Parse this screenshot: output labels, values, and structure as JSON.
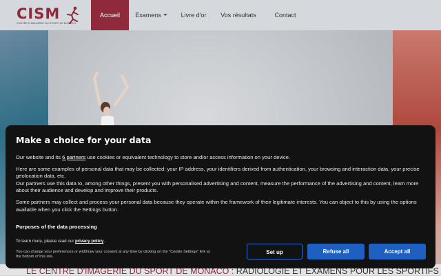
{
  "header": {
    "logo": {
      "name": "CISM",
      "subtitle": "CENTRE D'IMAGERIE DU SPORT DE MONACO"
    },
    "nav": [
      {
        "label": "Accueil",
        "active": true
      },
      {
        "label": "Examens",
        "has_dropdown": true
      },
      {
        "label": "Livre d'or"
      },
      {
        "label": "Vos résultats"
      },
      {
        "label": "Contact"
      }
    ]
  },
  "hero": {
    "tagline_part1": "LE CENTRE D'IMAGERIE DU SPORT DE MONACO :",
    "tagline_part2": "RADIOLOGIE ET EXAMENS POUR LES SPORTIFS"
  },
  "consent": {
    "title": "Make a choice for your data",
    "para1_before": "Our website and its ",
    "para1_link": "6 partners",
    "para1_after": " use cookies or equivalent technology to store and/or access information on your device.",
    "para2": "Here are some examples of personal data that may be collected: your IP address, your identifiers derived from authentication, your browsing and interaction data, your precise geolocation data, etc.",
    "para3": "Our partners use this data to, among other things, present you with personalised advertising and content, measure the performance of the advertising and content, learn more about their audience and develop and improve their products.",
    "para4": "Some partners may collect and process your personal data because they operate within the framework of their legitimate interests. You can object to this by using the options available when you click the Settings button.",
    "purposes_heading": "Purposes of the data processing",
    "learn_more_before": "To learn more, please read our ",
    "learn_more_link": "privacy policy",
    "learn_more_after": ".",
    "preferences_note": "You can change your preferences or widthraw your consent at any time by clicking on the \"Cookie Settings\" link at the bottom of this site.",
    "buttons": {
      "setup": "Set up",
      "refuse": "Refuse all",
      "accept": "Accept all"
    }
  },
  "colors": {
    "brand": "#8e2a3c",
    "modal_bg": "#121212",
    "button_blue": "#1e5fc2"
  }
}
